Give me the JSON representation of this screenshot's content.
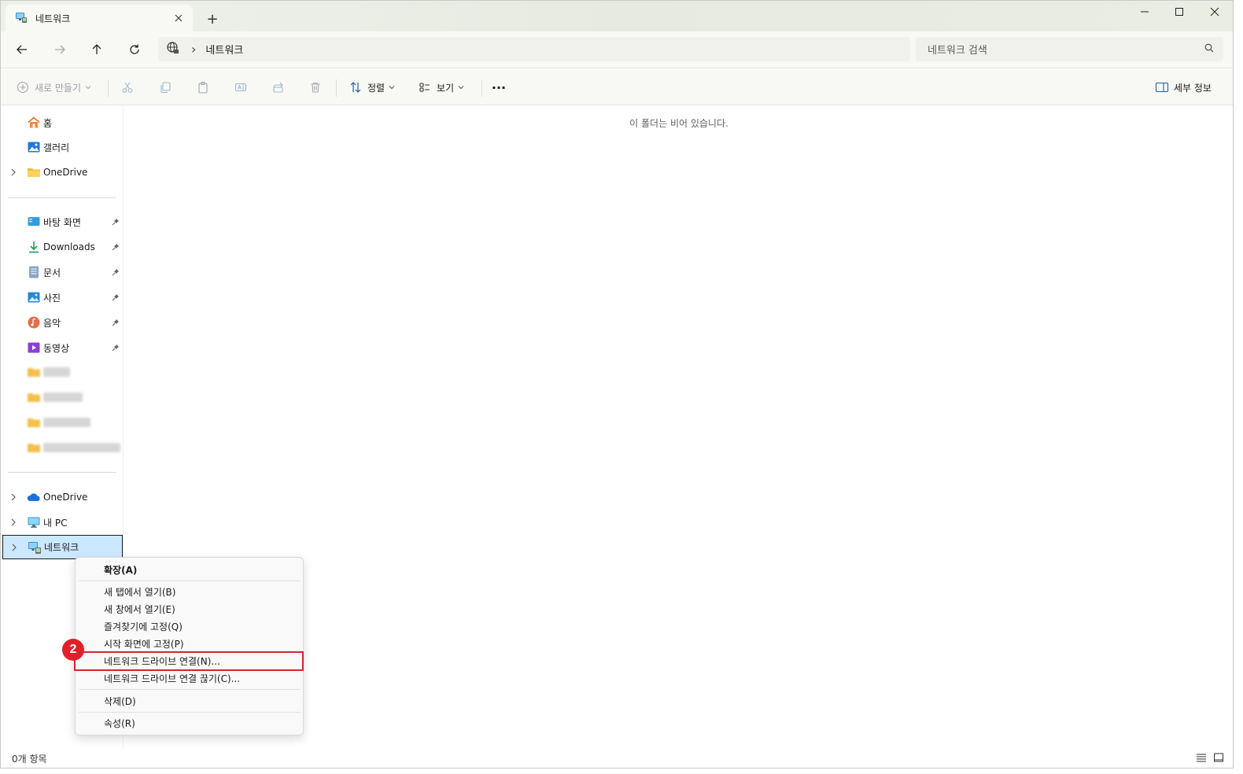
{
  "window": {
    "tab_title": "네트워크",
    "new_tab_label": "+"
  },
  "nav": {
    "breadcrumb_sep": "›",
    "address": "네트워크",
    "search_placeholder": "네트워크 검색"
  },
  "toolbar": {
    "new_label": "새로 만들기",
    "sort_label": "정렬",
    "view_label": "보기",
    "more_label": "···",
    "details_label": "세부 정보"
  },
  "sidebar": {
    "home": "홈",
    "gallery": "갤러리",
    "onedrive_top": "OneDrive",
    "desktop": "바탕 화면",
    "downloads": "Downloads",
    "documents": "문서",
    "pictures": "사진",
    "music": "음악",
    "videos": "동영상",
    "onedrive": "OneDrive",
    "this_pc": "내 PC",
    "network": "네트워크"
  },
  "main": {
    "empty_message": "이 폴더는 비어 있습니다."
  },
  "status": {
    "item_count": "0개 항목"
  },
  "context_menu": {
    "expand": "확장(A)",
    "open_new_tab": "새 탭에서 열기(B)",
    "open_new_window": "새 창에서 열기(E)",
    "pin_quick_access": "즐겨찾기에 고정(Q)",
    "pin_start": "시작 화면에 고정(P)",
    "map_drive": "네트워크 드라이브 연결(N)...",
    "disconnect_drive": "네트워크 드라이브 연결 끊기(C)...",
    "delete": "삭제(D)",
    "properties": "속성(R)"
  },
  "annotation": {
    "step_number": "2",
    "color": "#e0202a"
  },
  "colors": {
    "selection": "#cce8ff",
    "accent": "#0067c0",
    "highlight_border": "#d9232d"
  }
}
